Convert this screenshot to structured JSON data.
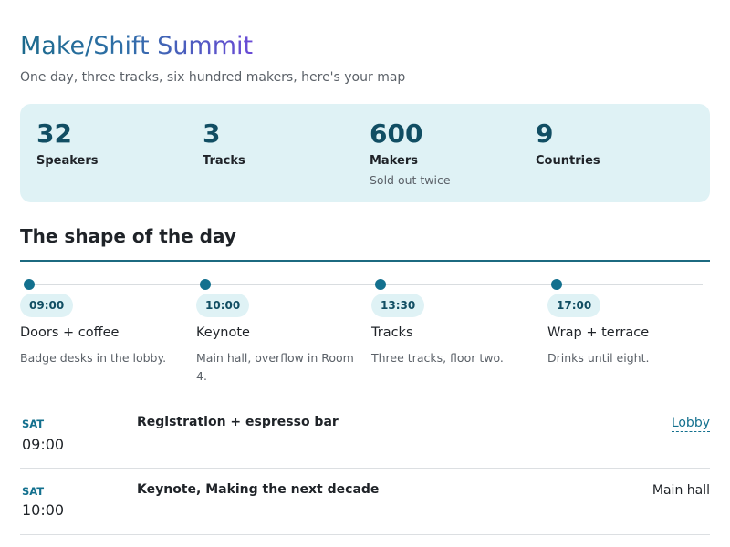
{
  "header": {
    "title": "Make/Shift Summit",
    "subtitle": "One day, three tracks, six hundred makers, here's your map"
  },
  "stats": [
    {
      "value": "32",
      "label": "Speakers",
      "note": ""
    },
    {
      "value": "3",
      "label": "Tracks",
      "note": ""
    },
    {
      "value": "600",
      "label": "Makers",
      "note": "Sold out twice"
    },
    {
      "value": "9",
      "label": "Countries",
      "note": ""
    }
  ],
  "timeline": {
    "heading": "The shape of the day",
    "stops": [
      {
        "time": "09:00",
        "title": "Doors + coffee",
        "desc": "Badge desks in the lobby."
      },
      {
        "time": "10:00",
        "title": "Keynote",
        "desc": "Main hall, overflow in Room 4."
      },
      {
        "time": "13:30",
        "title": "Tracks",
        "desc": "Three tracks, floor two."
      },
      {
        "time": "17:00",
        "title": "Wrap + terrace",
        "desc": "Drinks until eight."
      }
    ]
  },
  "schedule": [
    {
      "day": "SAT",
      "time": "09:00",
      "name": "Registration + espresso bar",
      "location": "Lobby",
      "location_is_link": true
    },
    {
      "day": "SAT",
      "time": "10:00",
      "name": "Keynote, Making the next decade",
      "location": "Main hall",
      "location_is_link": false
    }
  ],
  "colors": {
    "accent": "#13708e",
    "stats_bg": "#dff2f5",
    "title_gradient_start": "#1c6a8c",
    "title_gradient_end": "#6a4ad6"
  }
}
